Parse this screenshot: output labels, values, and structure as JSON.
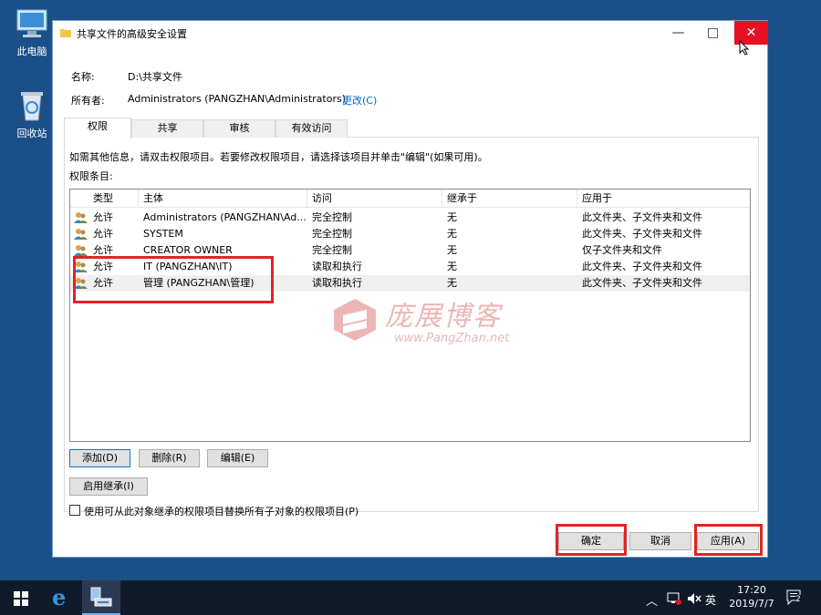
{
  "desktop": {
    "icons": [
      {
        "label": "此电脑",
        "icon": "computer-icon"
      },
      {
        "label": "回收站",
        "icon": "recycle-bin-icon"
      }
    ]
  },
  "window": {
    "title": "共享文件的高级安全设置",
    "controls": {
      "minimize": "—",
      "maximize": "□",
      "close": "✕"
    }
  },
  "info": {
    "name_label": "名称:",
    "name_value": "D:\\共享文件",
    "owner_label": "所有者:",
    "owner_value": "Administrators (PANGZHAN\\Administrators)",
    "change_link": "更改(C)"
  },
  "tabs": [
    {
      "label": "权限",
      "active": true
    },
    {
      "label": "共享",
      "active": false
    },
    {
      "label": "审核",
      "active": false
    },
    {
      "label": "有效访问",
      "active": false
    }
  ],
  "panel": {
    "hint": "如需其他信息，请双击权限项目。若要修改权限项目，请选择该项目并单击\"编辑\"(如果可用)。",
    "entries_label": "权限条目:"
  },
  "table": {
    "columns": [
      "类型",
      "主体",
      "访问",
      "继承于",
      "应用于"
    ],
    "rows": [
      {
        "type": "允许",
        "principal": "Administrators (PANGZHAN\\Ad...",
        "access": "完全控制",
        "inherited": "无",
        "applies": "此文件夹、子文件夹和文件"
      },
      {
        "type": "允许",
        "principal": "SYSTEM",
        "access": "完全控制",
        "inherited": "无",
        "applies": "此文件夹、子文件夹和文件"
      },
      {
        "type": "允许",
        "principal": "CREATOR OWNER",
        "access": "完全控制",
        "inherited": "无",
        "applies": "仅子文件夹和文件"
      },
      {
        "type": "允许",
        "principal": "IT (PANGZHAN\\IT)",
        "access": "读取和执行",
        "inherited": "无",
        "applies": "此文件夹、子文件夹和文件"
      },
      {
        "type": "允许",
        "principal": "管理 (PANGZHAN\\管理)",
        "access": "读取和执行",
        "inherited": "无",
        "applies": "此文件夹、子文件夹和文件"
      }
    ]
  },
  "buttons": {
    "add": "添加(D)",
    "remove": "删除(R)",
    "edit": "编辑(E)",
    "enable_inheritance": "启用继承(I)",
    "replace_label": "使用可从此对象继承的权限项目替换所有子对象的权限项目(P)",
    "ok": "确定",
    "cancel": "取消",
    "apply": "应用(A)"
  },
  "watermark": {
    "title": "庞展博客",
    "url": "www.PangZhan.net"
  },
  "taskbar": {
    "ime": "英",
    "time": "17:20",
    "date": "2019/7/7",
    "notifications": "2"
  },
  "colors": {
    "accent": "#0078d7",
    "close_red": "#e81123",
    "highlight_red": "#e02424",
    "taskbar": "#101a2a"
  }
}
